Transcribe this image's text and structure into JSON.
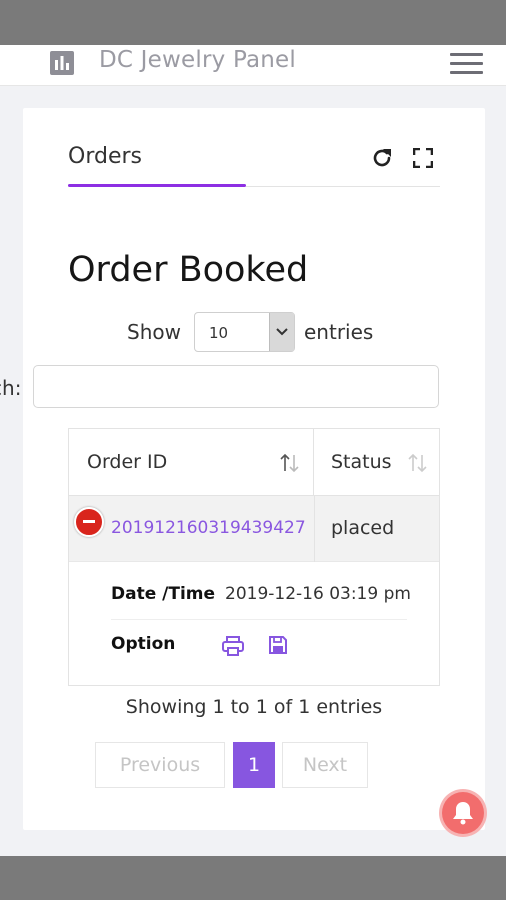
{
  "app": {
    "title": "DC Jewelry Panel"
  },
  "tabs": {
    "active": "Orders"
  },
  "page": {
    "heading": "Order Booked"
  },
  "length": {
    "show": "Show",
    "value": "10",
    "entries": "entries"
  },
  "search": {
    "label": "Search:",
    "placeholder": "",
    "value": ""
  },
  "table": {
    "columns": [
      "Order ID",
      "Status"
    ],
    "rows": [
      {
        "order_id": "201912160319439427",
        "status": "placed"
      }
    ],
    "details": {
      "datetime_label": "Date /Time",
      "datetime_value": "2019-12-16 03:19 pm",
      "option_label": "Option"
    }
  },
  "info": "Showing 1 to 1 of 1 entries",
  "pagination": {
    "previous": "Previous",
    "page": "1",
    "next": "Next"
  },
  "colors": {
    "accent": "#8d2fe3",
    "link": "#8a57e0",
    "danger": "#d9251d",
    "notify": "#f26d6d"
  },
  "icons": [
    "bar-chart-icon",
    "hamburger-icon",
    "refresh-icon",
    "expand-icon",
    "chevron-down-icon",
    "sort-icon",
    "collapse-icon",
    "print-icon",
    "save-icon",
    "bell-icon"
  ]
}
